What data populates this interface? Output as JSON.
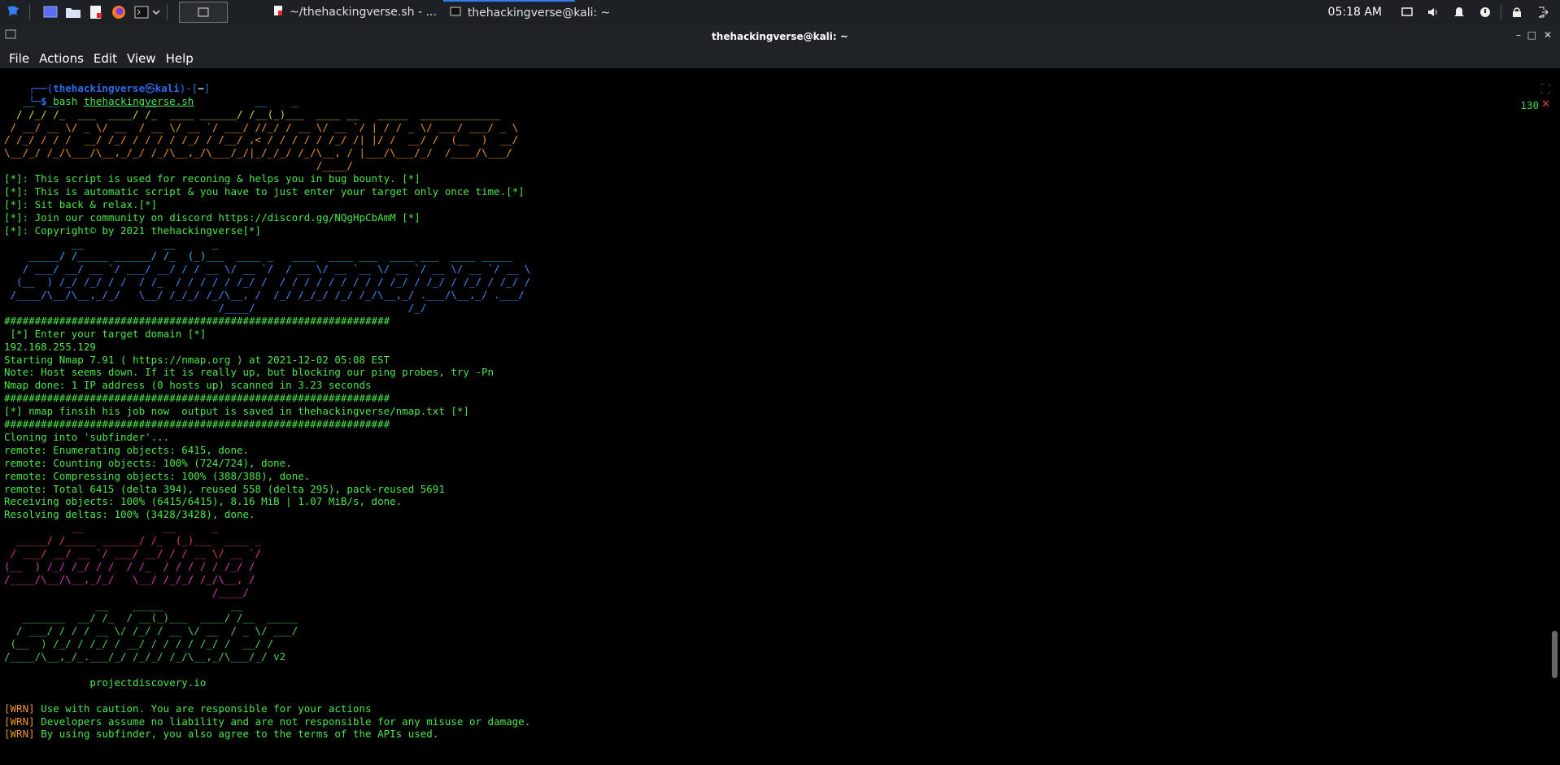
{
  "taskbar": {
    "tasks": [
      {
        "label": "~/thehackingverse.sh - ...",
        "active": false
      },
      {
        "label": "thehackingverse@kali: ~",
        "active": true
      }
    ],
    "clock": "05:18 AM",
    "icons": [
      "kali-menu-icon",
      "desktop-icon",
      "files-icon",
      "text-editor-icon",
      "firefox-icon",
      "terminal-icon",
      "chevron-down-icon",
      "window-thumbnail",
      "display-icon",
      "volume-icon",
      "bell-icon",
      "power-icon",
      "lock-icon",
      "logout-icon"
    ]
  },
  "window": {
    "title": "thehackingverse@kali: ~"
  },
  "menu": [
    "File",
    "Actions",
    "Edit",
    "View",
    "Help"
  ],
  "terminal": {
    "prompt_user": "thehackingverse",
    "prompt_at": "㉿",
    "prompt_host": "kali",
    "prompt_dir": "~",
    "command": "bash",
    "command_arg": "thehackingverse.sh",
    "exit_code": "130",
    "lines": [
      {
        "c": "cyan",
        "t": "   __  __              __                __    _"
      },
      {
        "c": "yel",
        "t": "  / /_/ /_  ___  ____/ /_  ____ ______/ /__(_)___  ____ __   _____  _____________"
      },
      {
        "c": "ora",
        "t": " / __/ __ \\/ _ \\/ __  / __ \\/ __ `/ ___/ //_/ / __ \\/ __ `/ | / / _ \\/ ___/ ___/ _ \\"
      },
      {
        "c": "ora",
        "t": "/ /_/ / / /  __/ /_/ / / / / /_/ / /__/ ,< / / / / / /_/ /| |/ /  __/ /  (__  )  __/"
      },
      {
        "c": "ora",
        "t": "\\__/_/ /_/\\___/\\__,_/_/ /_/\\__,_/\\___/_/|_/_/_/ /_/\\__, / |___/\\___/_/  /____/\\___/"
      },
      {
        "c": "ora",
        "t": "                                                   /____/"
      },
      {
        "c": "g",
        "t": "[*]: This script is used for reconing & helps you in bug bounty. [*]"
      },
      {
        "c": "g",
        "t": "[*]: This is automatic script & you have to just enter your target only once time.[*]"
      },
      {
        "c": "g",
        "t": "[*]: Sit back & relax.[*]"
      },
      {
        "c": "g",
        "t": "[*]: Join our community on discord https://discord.gg/NQgHpCbAmM [*]"
      },
      {
        "c": "g",
        "t": "[*]: Copyright© by 2021 thehackingverse[*]"
      },
      {
        "c": "cyan",
        "t": "           __             __      _"
      },
      {
        "c": "cyan",
        "t": "    _____/ /_____ ______/ /_  (_)___  ____ _   ____  ____ ___  ____ ___  ____ _____"
      },
      {
        "c": "blue",
        "t": "   / ___/ __/ __ `/ ___/ __/ / / __ \\/ __ `/  / __ \\/ __ `__ \\/ __ `/ __ \\/ __ `/ __ \\"
      },
      {
        "c": "blue",
        "t": "  (__  ) /_/ /_/ / /  / /_  / / / / / /_/ /  / / / / / / / / / /_/ / /_/ / /_/ / /_/ /"
      },
      {
        "c": "blue",
        "t": " /____/\\__/\\__,_/_/   \\__/ /_/_/ /_/\\__, /  /_/ /_/_/ /_/ /_/\\__,_/ .___/\\__,_/ .___/"
      },
      {
        "c": "blue",
        "t": "                                   /____/                         /_/"
      },
      {
        "c": "g",
        "t": "###############################################################"
      },
      {
        "c": "g",
        "t": " [*] Enter your target domain [*]"
      },
      {
        "c": "g",
        "t": "192.168.255.129"
      },
      {
        "c": "g",
        "t": "Starting Nmap 7.91 ( https://nmap.org ) at 2021-12-02 05:08 EST"
      },
      {
        "c": "g",
        "t": "Note: Host seems down. If it is really up, but blocking our ping probes, try -Pn"
      },
      {
        "c": "g",
        "t": "Nmap done: 1 IP address (0 hosts up) scanned in 3.23 seconds"
      },
      {
        "c": "g",
        "t": "###############################################################"
      },
      {
        "c": "g",
        "t": "[*] nmap finsih his job now  output is saved in thehackingverse/nmap.txt [*]"
      },
      {
        "c": "g",
        "t": "###############################################################"
      },
      {
        "c": "g",
        "t": "Cloning into 'subfinder'..."
      },
      {
        "c": "g",
        "t": "remote: Enumerating objects: 6415, done."
      },
      {
        "c": "g",
        "t": "remote: Counting objects: 100% (724/724), done."
      },
      {
        "c": "g",
        "t": "remote: Compressing objects: 100% (388/388), done."
      },
      {
        "c": "g",
        "t": "remote: Total 6415 (delta 394), reused 558 (delta 295), pack-reused 5691"
      },
      {
        "c": "g",
        "t": "Receiving objects: 100% (6415/6415), 8.16 MiB | 1.07 MiB/s, done."
      },
      {
        "c": "g",
        "t": "Resolving deltas: 100% (3428/3428), done."
      },
      {
        "c": "red",
        "t": "           __             __      _"
      },
      {
        "c": "red",
        "t": "  _____/ /_____ ______/ /_  (_)___  ____ _"
      },
      {
        "c": "red",
        "t": " / ___/ __/ __ `/ ___/ __/ / / __ \\/ __ `/"
      },
      {
        "c": "mag",
        "t": "(__  ) /_/ /_/ / /  / /_  / / / / / /_/ /"
      },
      {
        "c": "mag",
        "t": "/____/\\__/\\__,_/_/   \\__/ /_/_/ /_/\\__, /"
      },
      {
        "c": "mag",
        "t": "                                  /____/"
      },
      {
        "c": "grn2",
        "t": "               __    _____           __"
      },
      {
        "c": "grn2",
        "t": "   _______  __/ /_  / __(_)___  ____/ /__  _____"
      },
      {
        "c": "grn2",
        "t": "  / ___/ / / / __ \\/ /_/ / __ \\/ __  / _ \\/ ___/"
      },
      {
        "c": "grn2",
        "t": " (__  ) /_/ / /_/ / __/ / / / / /_/ /  __/ /"
      },
      {
        "c": "grn2",
        "t": "/____/\\__,_/_.___/_/ /_/_/ /_/\\__,_/\\___/_/ v2"
      },
      {
        "c": "g",
        "t": ""
      },
      {
        "c": "g",
        "t": "              projectdiscovery.io"
      },
      {
        "c": "g",
        "t": ""
      },
      {
        "c": "warn",
        "t": "Use with caution. You are responsible for your actions"
      },
      {
        "c": "warn",
        "t": "Developers assume no liability and are not responsible for any misuse or damage."
      },
      {
        "c": "warn",
        "t": "By using subfinder, you also agree to the terms of the APIs used."
      }
    ],
    "warn_tag": "[WRN]"
  }
}
